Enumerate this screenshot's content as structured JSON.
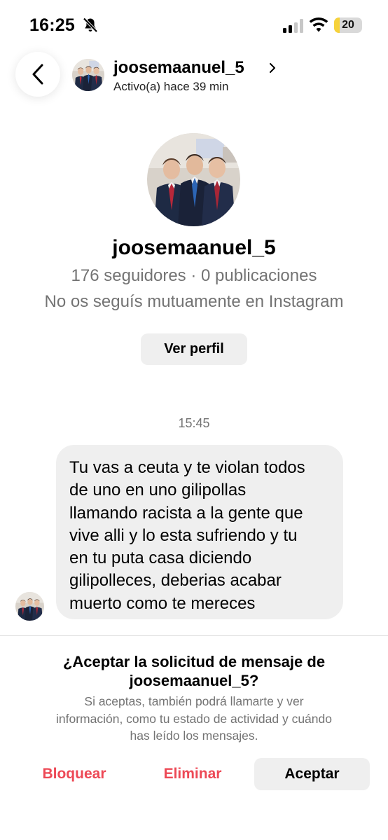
{
  "status_bar": {
    "time": "16:25",
    "battery_level": "20",
    "battery_fraction": 0.2,
    "icons": [
      "bell-slash-icon",
      "cellular-signal-icon",
      "wifi-icon",
      "battery-icon"
    ],
    "battery_color": "#f6d23a"
  },
  "header": {
    "username": "joosemaanuel_5",
    "activity": "Activo(a) hace 39 min",
    "icons": [
      "chevron-left-icon",
      "chevron-right-icon"
    ]
  },
  "profile": {
    "username": "joosemaanuel_5",
    "stats": "176 seguidores · 0 publicaciones",
    "mutual": "No os seguís mutuamente en Instagram",
    "view_profile_label": "Ver perfil"
  },
  "conversation": {
    "timestamp": "15:45",
    "message_lines": [
      "Tu vas a ceuta y te violan todos",
      "de uno en uno gilipollas",
      "llamando racista a la gente que",
      "vive alli y lo esta sufriendo y tu",
      "en tu puta casa diciendo",
      "gilipolleces, deberias acabar",
      "muerto como te mereces"
    ]
  },
  "request": {
    "title_line_1": "¿Aceptar la solicitud de mensaje de",
    "title_line_2": "joosemaanuel_5?",
    "desc_line_1": "Si aceptas, también podrá llamarte y ver",
    "desc_line_2": "información, como tu estado de actividad y cuándo",
    "desc_line_3": "has leído los mensajes."
  },
  "actions": {
    "block_label": "Bloquear",
    "delete_label": "Eliminar",
    "accept_label": "Aceptar"
  },
  "colors": {
    "destructive": "#ed4956",
    "secondary_text": "#737373",
    "bubble_bg": "#efefef"
  }
}
